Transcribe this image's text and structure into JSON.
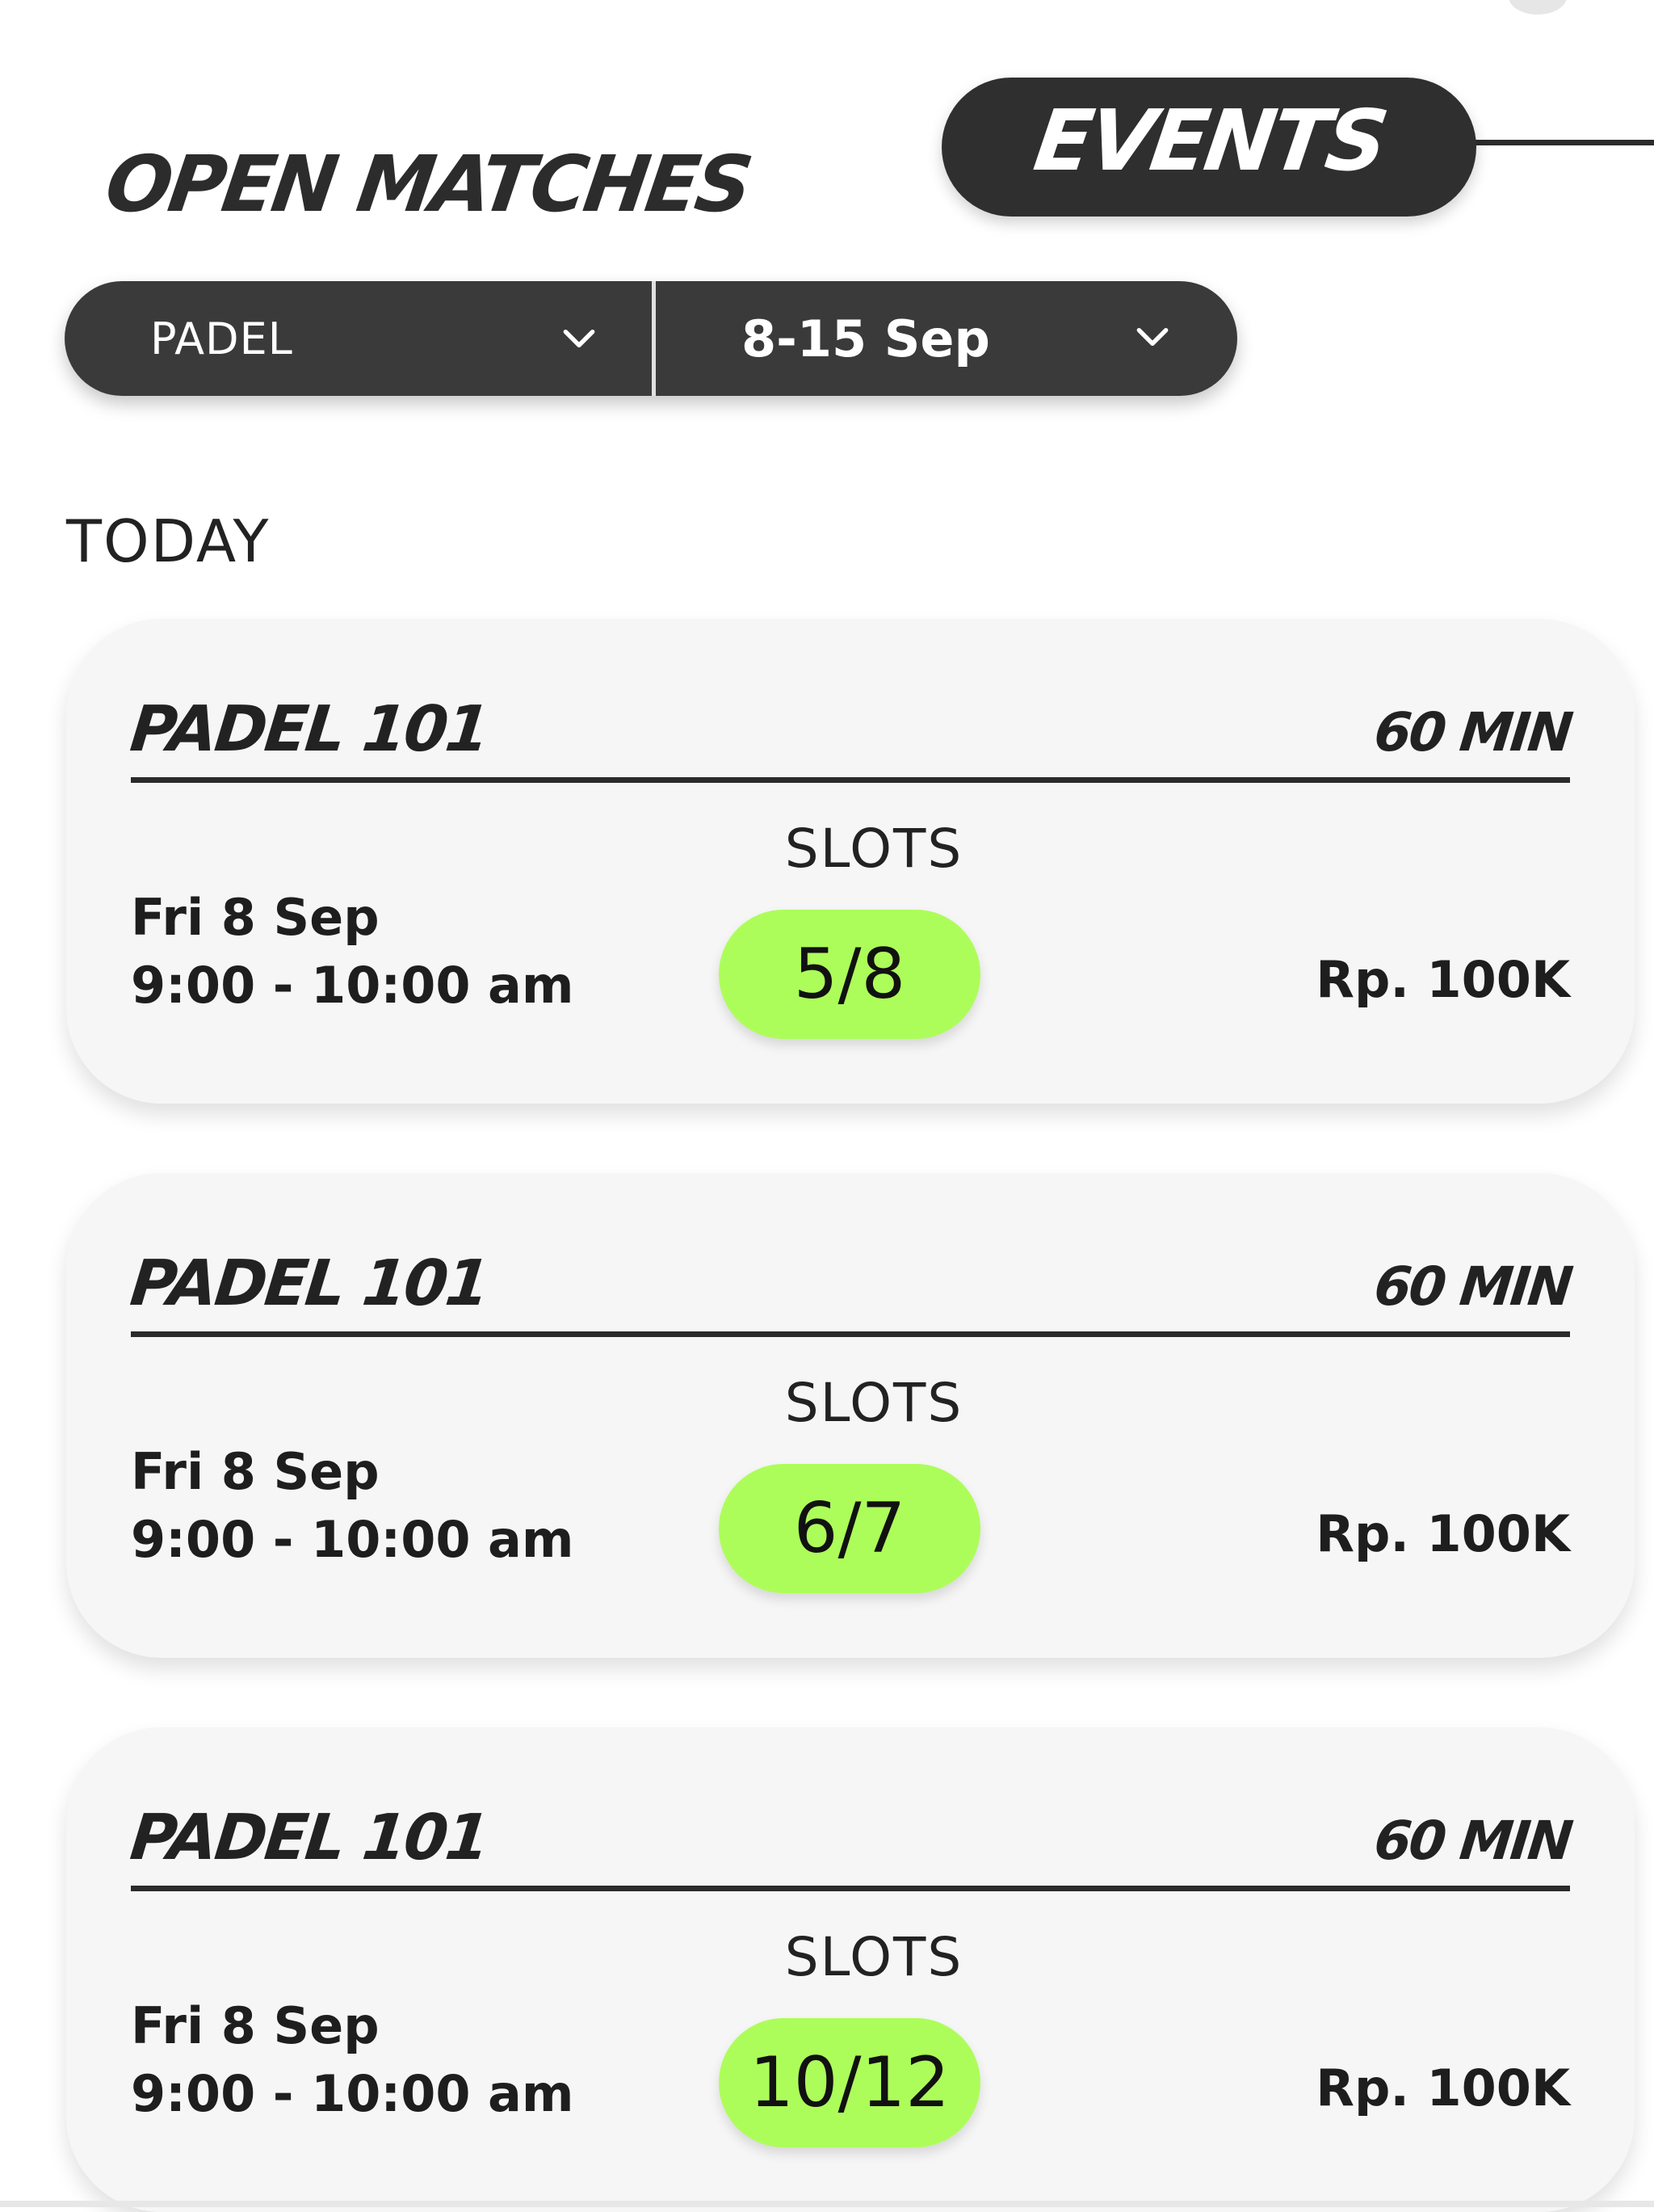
{
  "tabs": {
    "open_matches": "OPEN MATCHES",
    "events": "EVENTS",
    "active": "EVENTS"
  },
  "filters": {
    "sport": {
      "label": "PADEL",
      "icon": "chevron-down-icon"
    },
    "date_range": {
      "label": "8-15 Sep",
      "icon": "chevron-down-icon"
    }
  },
  "section": {
    "title": "TODAY"
  },
  "events": [
    {
      "title": "PADEL 101",
      "duration": "60 MIN",
      "date": "Fri 8 Sep",
      "time": "9:00 - 10:00 am",
      "slots_label": "SLOTS",
      "slots": "5/8",
      "price": "Rp. 100K"
    },
    {
      "title": "PADEL 101",
      "duration": "60 MIN",
      "date": "Fri 8 Sep",
      "time": "9:00 - 10:00 am",
      "slots_label": "SLOTS",
      "slots": "6/7",
      "price": "Rp. 100K"
    },
    {
      "title": "PADEL 101",
      "duration": "60 MIN",
      "date": "Fri 8 Sep",
      "time": "9:00 - 10:00 am",
      "slots_label": "SLOTS",
      "slots": "10/12",
      "price": "Rp. 100K"
    }
  ],
  "colors": {
    "dark": "#2f2f2f",
    "card_bg": "#f6f6f6",
    "slots_pill": "#adfd5a"
  }
}
